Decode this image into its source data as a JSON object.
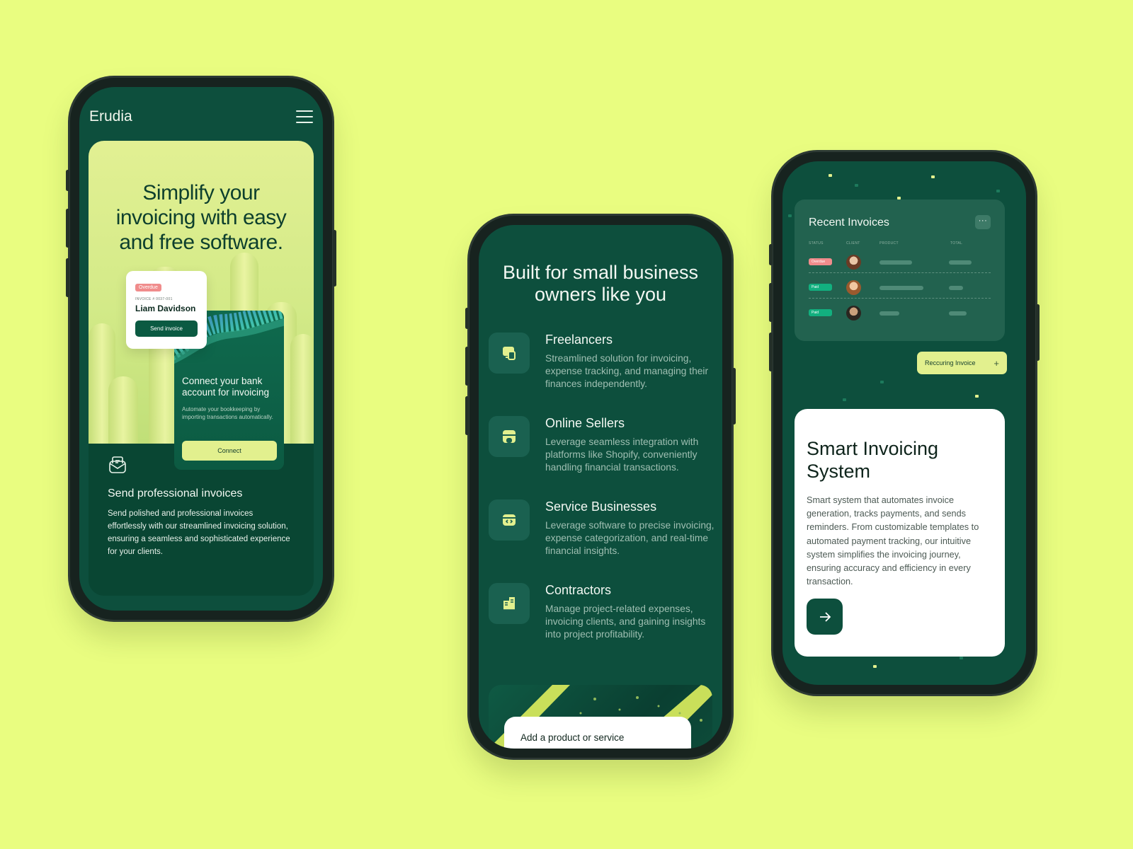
{
  "colors": {
    "background": "#e9fd80",
    "primary_dark_green": "#0d4f3d",
    "accent_lime": "#e2f08e",
    "overdue": "#f08c8c",
    "paid": "#12b07f"
  },
  "phone1": {
    "logo": "Erudia",
    "menu_icon": "hamburger-icon",
    "hero_title": "Simplify your invoicing with easy and free software.",
    "invoice_card": {
      "status": "Overdue",
      "invoice_number": "INVOICE # 0037-001",
      "client_name": "Liam Davidson",
      "button_label": "Send invoice"
    },
    "bank_card": {
      "title": "Connect your bank account for invoicing",
      "description": "Automate your bookkeeping by importing transactions automatically.",
      "button_label": "Connect"
    },
    "feature": {
      "icon": "mail-icon",
      "title": "Send professional invoices",
      "description": "Send polished and professional invoices effortlessly with our streamlined invoicing solution, ensuring a seamless and sophisticated experience for your clients."
    }
  },
  "phone2": {
    "title": "Built for small business owners like you",
    "segments": [
      {
        "icon": "devices-icon",
        "title": "Freelancers",
        "description": "Streamlined solution for invoicing, expense tracking, and managing their finances independently."
      },
      {
        "icon": "storefront-icon",
        "title": "Online Sellers",
        "description": "Leverage seamless integration with platforms like Shopify, conveniently handling financial transactions."
      },
      {
        "icon": "code-browser-icon",
        "title": "Service Businesses",
        "description": "Leverage software to precise invoicing, expense categorization, and real-time financial insights."
      },
      {
        "icon": "buildings-icon",
        "title": "Contractors",
        "description": "Manage project-related expenses, invoicing clients, and gaining insights into project profitability."
      }
    ],
    "bottom_card_label": "Add a product or service"
  },
  "phone3": {
    "recent_invoices": {
      "title": "Recent Invoices",
      "menu_label": "···",
      "columns": [
        "STATUS",
        "CLIENT",
        "PRODUCT",
        "TOTAL"
      ],
      "rows": [
        {
          "status": "Overdue",
          "avatar": "avatar-woman-curly"
        },
        {
          "status": "Paid",
          "avatar": "avatar-woman"
        },
        {
          "status": "Paid",
          "avatar": "avatar-man"
        }
      ]
    },
    "recurring_button": "Reccuring Invoice",
    "smart_card": {
      "title": "Smart Invoicing System",
      "description": "Smart system that automates invoice generation, tracks payments, and sends reminders. From customizable templates to automated payment tracking, our intuitive system simplifies the invoicing journey, ensuring accuracy and efficiency in every transaction.",
      "button_icon": "arrow-right-icon"
    }
  }
}
